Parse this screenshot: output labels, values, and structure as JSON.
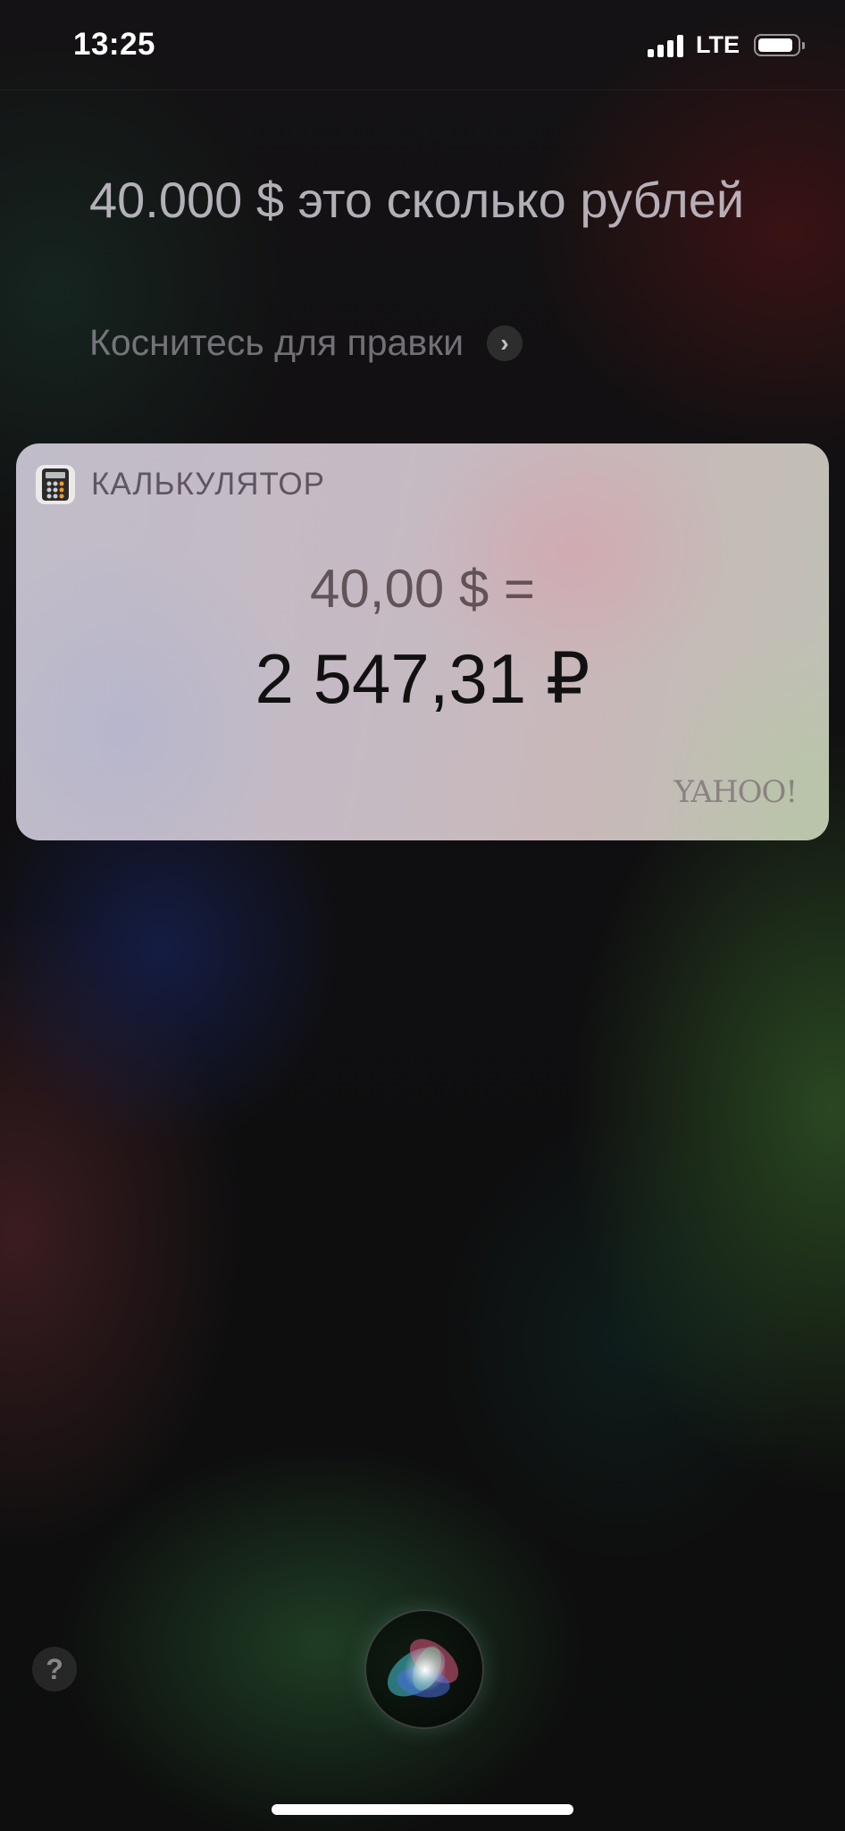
{
  "status_bar": {
    "time": "13:25",
    "network": "LTE"
  },
  "siri": {
    "query": "40.000 $ это сколько рублей",
    "edit_hint": "Коснитесь для правки",
    "help_label": "?"
  },
  "card": {
    "app_name": "КАЛЬКУЛЯТОР",
    "from_value": "40,00 $ =",
    "to_value": "2 547,31 ₽",
    "provider": "YAHOO!"
  },
  "icons": {
    "signal": "cellular-signal-icon",
    "battery": "battery-icon",
    "edit_chevron": "chevron-right-icon",
    "app": "calculator-icon",
    "siri": "siri-orb-icon"
  }
}
